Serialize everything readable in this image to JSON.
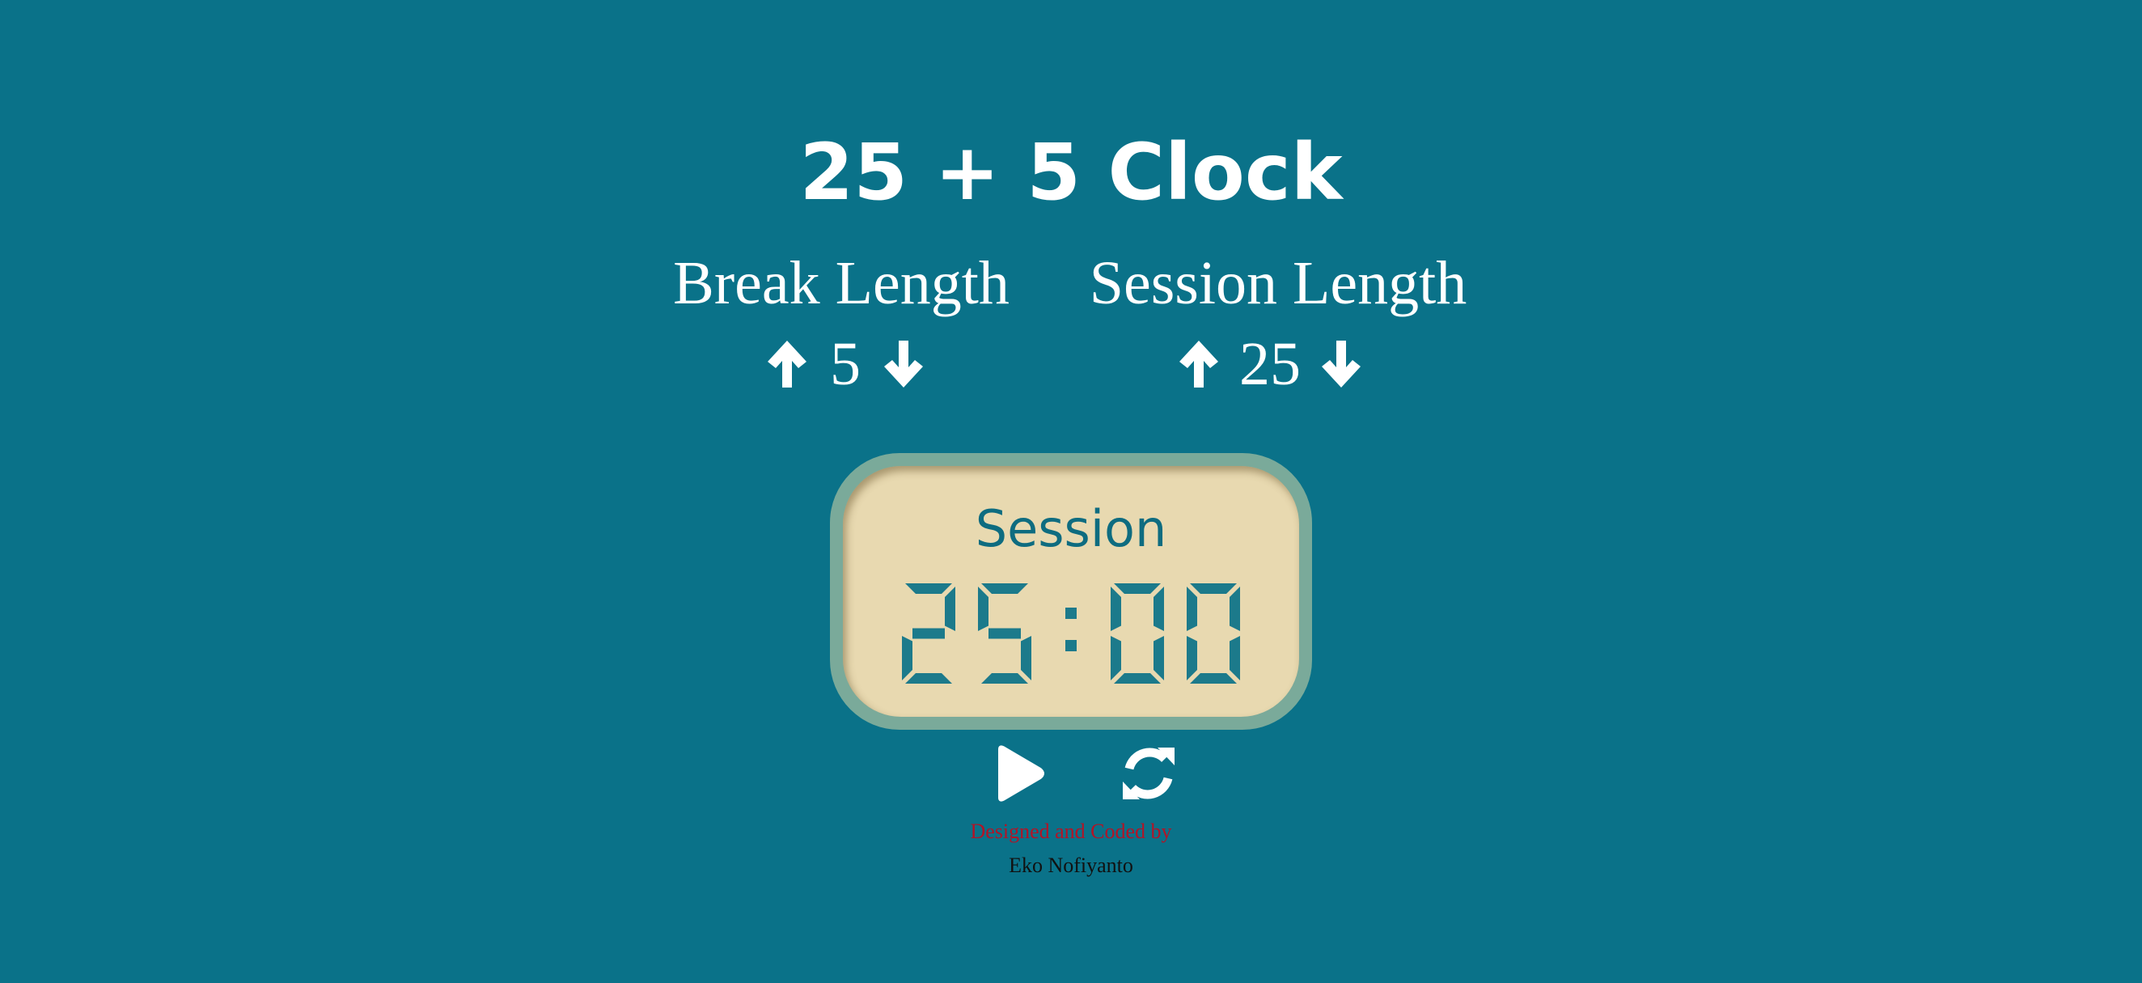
{
  "title": "25 + 5 Clock",
  "break": {
    "label": "Break Length",
    "value": "5",
    "increment_icon": "arrow-up-icon",
    "decrement_icon": "arrow-down-icon"
  },
  "session": {
    "label": "Session Length",
    "value": "25",
    "increment_icon": "arrow-up-icon",
    "decrement_icon": "arrow-down-icon"
  },
  "timer": {
    "label": "Session",
    "time_left": "25:00"
  },
  "controls": {
    "start_stop_icon": "play-icon",
    "reset_icon": "refresh-icon"
  },
  "credits": {
    "line1": "Designed and Coded by",
    "line2": "Eko Nofiyanto"
  },
  "colors": {
    "background": "#0a7289",
    "clock_face": "#e8d9b0",
    "clock_bezel": "#7aaa9a",
    "clock_digits": "#1c7a8b",
    "credit_accent": "#b21427"
  }
}
